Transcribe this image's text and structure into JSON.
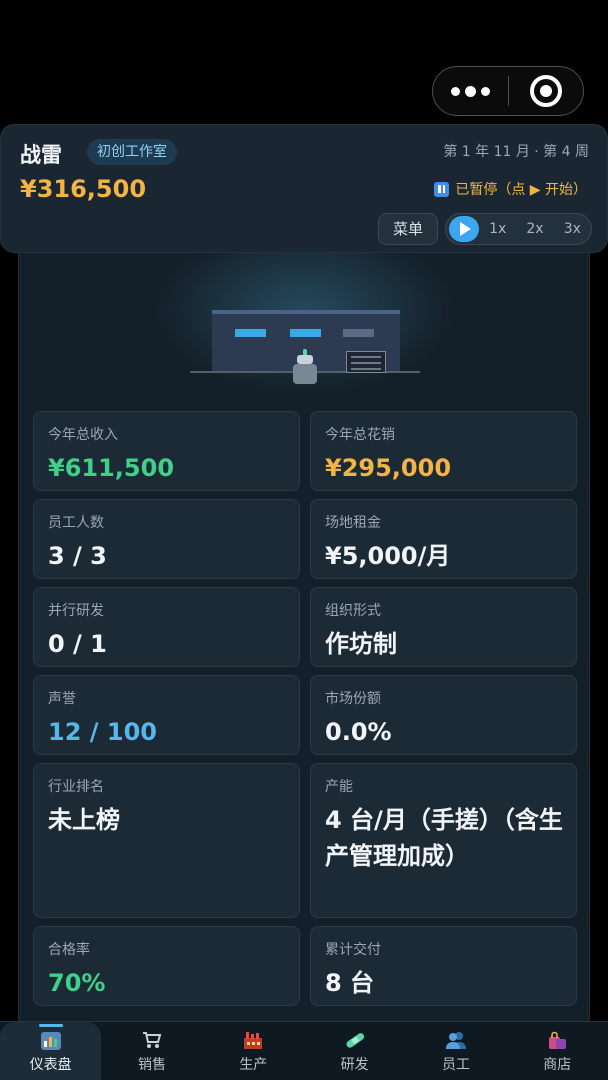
{
  "header": {
    "company_name": "战雷",
    "stage_badge": "初创工作室",
    "date": "第 1 年 11 月 · 第 4 周",
    "money": "¥316,500",
    "pause_status": "已暂停（点 ▶ 开始）",
    "menu_label": "菜单",
    "speeds": [
      "1x",
      "2x",
      "3x"
    ]
  },
  "stats": [
    {
      "label": "今年总收入",
      "value": "¥611,500",
      "color": "#3fd08a"
    },
    {
      "label": "今年总花销",
      "value": "¥295,000",
      "color": "#f4b444"
    },
    {
      "label": "员工人数",
      "value": "3 / 3"
    },
    {
      "label": "场地租金",
      "value": "¥5,000/月"
    },
    {
      "label": "并行研发",
      "value": "0 / 1"
    },
    {
      "label": "组织形式",
      "value": "作坊制"
    },
    {
      "label": "声誉",
      "value": "12 / 100",
      "color": "#56b8ea"
    },
    {
      "label": "市场份额",
      "value": "0.0%"
    },
    {
      "label": "行业排名",
      "value": "未上榜"
    },
    {
      "label": "产能",
      "value": "4 台/月（手搓）（含生产管理加成）"
    },
    {
      "label": "合格率",
      "value": "70%",
      "color": "#3fd08a"
    },
    {
      "label": "累计交付",
      "value": "8 台"
    }
  ],
  "tabs": [
    {
      "label": "仪表盘",
      "icon": "dashboard-icon",
      "active": true
    },
    {
      "label": "销售",
      "icon": "cart-icon"
    },
    {
      "label": "生产",
      "icon": "factory-icon"
    },
    {
      "label": "研发",
      "icon": "bandage-icon"
    },
    {
      "label": "员工",
      "icon": "people-icon"
    },
    {
      "label": "商店",
      "icon": "shopping-bag-icon"
    }
  ],
  "colors": {
    "accent": "#56b8ea",
    "gold": "#f4b444",
    "green": "#3fd08a",
    "background": "#142029"
  }
}
